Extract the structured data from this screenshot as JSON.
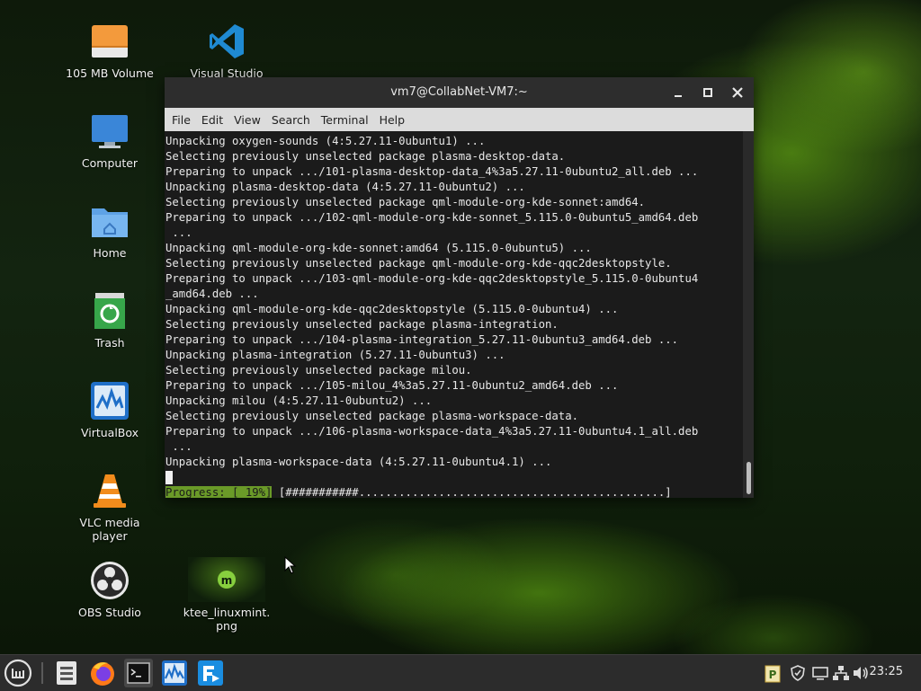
{
  "desktop": {
    "icons": [
      {
        "label": "105 MB Volume"
      },
      {
        "label": "Visual Studio"
      },
      {
        "label": "Computer"
      },
      {
        "label": "Home"
      },
      {
        "label": "Trash"
      },
      {
        "label": "VirtualBox"
      },
      {
        "label": "VLC media player"
      },
      {
        "label": "OBS Studio"
      },
      {
        "label": "ktee_linuxmint.\npng"
      }
    ]
  },
  "window": {
    "title": "vm7@CollabNet-VM7:~",
    "menu": [
      "File",
      "Edit",
      "View",
      "Search",
      "Terminal",
      "Help"
    ],
    "lines": [
      "Unpacking oxygen-sounds (4:5.27.11-0ubuntu1) ...",
      "Selecting previously unselected package plasma-desktop-data.",
      "Preparing to unpack .../101-plasma-desktop-data_4%3a5.27.11-0ubuntu2_all.deb ...",
      "Unpacking plasma-desktop-data (4:5.27.11-0ubuntu2) ...",
      "Selecting previously unselected package qml-module-org-kde-sonnet:amd64.",
      "Preparing to unpack .../102-qml-module-org-kde-sonnet_5.115.0-0ubuntu5_amd64.deb",
      " ...",
      "Unpacking qml-module-org-kde-sonnet:amd64 (5.115.0-0ubuntu5) ...",
      "Selecting previously unselected package qml-module-org-kde-qqc2desktopstyle.",
      "Preparing to unpack .../103-qml-module-org-kde-qqc2desktopstyle_5.115.0-0ubuntu4",
      "_amd64.deb ...",
      "Unpacking qml-module-org-kde-qqc2desktopstyle (5.115.0-0ubuntu4) ...",
      "Selecting previously unselected package plasma-integration.",
      "Preparing to unpack .../104-plasma-integration_5.27.11-0ubuntu3_amd64.deb ...",
      "Unpacking plasma-integration (5.27.11-0ubuntu3) ...",
      "Selecting previously unselected package milou.",
      "Preparing to unpack .../105-milou_4%3a5.27.11-0ubuntu2_amd64.deb ...",
      "Unpacking milou (4:5.27.11-0ubuntu2) ...",
      "Selecting previously unselected package plasma-workspace-data.",
      "Preparing to unpack .../106-plasma-workspace-data_4%3a5.27.11-0ubuntu4.1_all.deb",
      " ...",
      "Unpacking plasma-workspace-data (4:5.27.11-0ubuntu4.1) ..."
    ],
    "progress_label": "Progress: [ 19%]",
    "progress_bar": " [###########..............................................]"
  },
  "taskbar": {
    "clock": "23:25"
  },
  "colors": {
    "terminal_bg": "#1b1b1b",
    "progress_green": "#6a9a28",
    "taskbar_bg": "#2c2c2c"
  }
}
